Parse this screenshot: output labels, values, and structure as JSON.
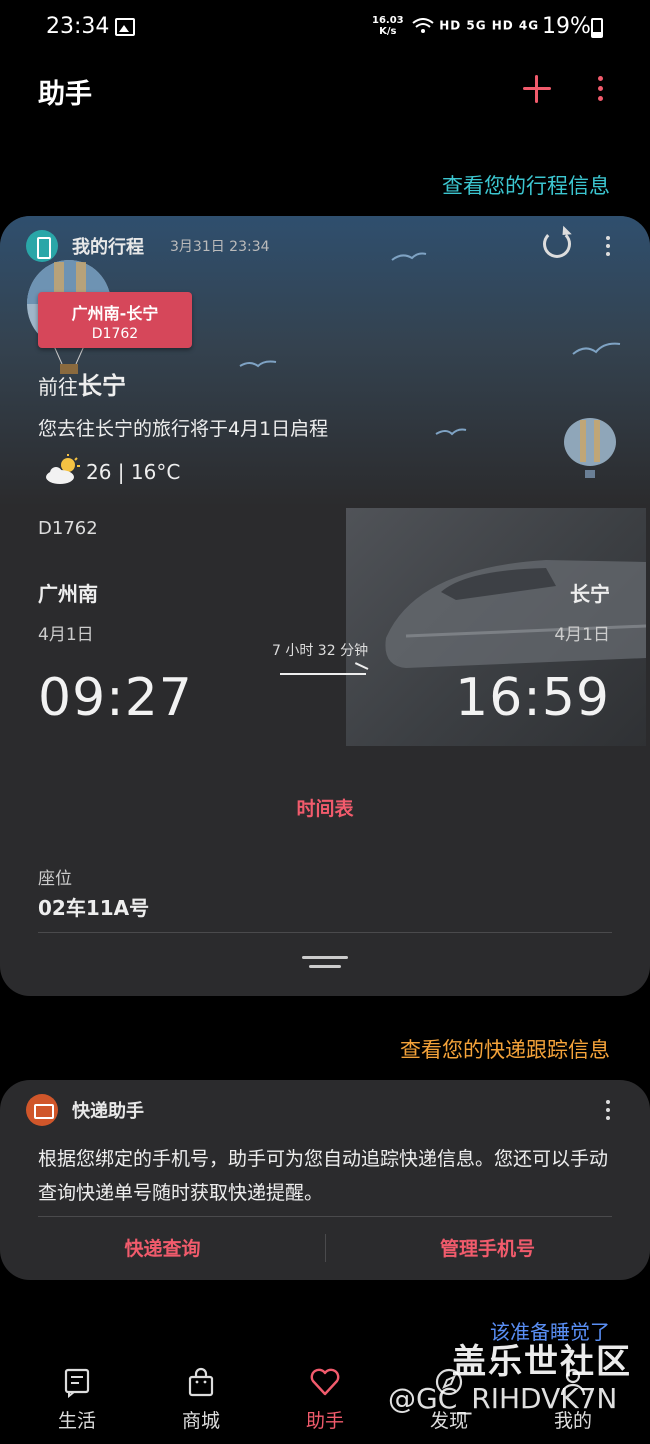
{
  "status_bar": {
    "time": "23:34",
    "speed_value": "16.03",
    "speed_unit": "K/s",
    "network": "HD 5G HD 4G",
    "battery": "19%"
  },
  "header": {
    "title": "助手",
    "add_icon": "plus-icon",
    "more_icon": "more-vertical-icon"
  },
  "trip_section": {
    "link": "查看您的行程信息",
    "card": {
      "title": "我的行程",
      "timestamp": "3月31日 23:34",
      "route_tag": {
        "name": "广州南-长宁",
        "code": "D1762"
      },
      "destination_prefix": "前往",
      "destination": "长宁",
      "description": "您去往长宁的旅行将于4月1日启程",
      "weather": "26 | 16°C",
      "train_code": "D1762",
      "from": {
        "station": "广州南",
        "date": "4月1日",
        "time": "09:27"
      },
      "to": {
        "station": "长宁",
        "date": "4月1日",
        "time": "16:59"
      },
      "duration": "7 小时 32 分钟",
      "timetable_label": "时间表",
      "seat_label": "座位",
      "seat_value": "02车11A号"
    }
  },
  "express_section": {
    "link": "查看您的快递跟踪信息",
    "card": {
      "title": "快递助手",
      "body": "根据您绑定的手机号，助手可为您自动追踪快递信息。您还可以手动查询快递单号随时获取快递提醒。",
      "button_query": "快递查询",
      "button_manage": "管理手机号"
    }
  },
  "sleep_link": "该准备睡觉了",
  "bottom_nav": [
    {
      "label": "生活",
      "icon": "life-icon"
    },
    {
      "label": "商城",
      "icon": "shop-bag-icon"
    },
    {
      "label": "助手",
      "icon": "heart-icon",
      "active": true
    },
    {
      "label": "发现",
      "icon": "discover-icon"
    },
    {
      "label": "我的",
      "icon": "profile-icon"
    }
  ],
  "watermark": {
    "main": "盖乐世社区",
    "sub": "@GC_RIHDVK7N"
  },
  "colors": {
    "accent": "#f15b6c",
    "trip_link": "#3cc6d0",
    "express_link": "#f5a33a",
    "sleep_link": "#5a8ff5",
    "card_bg": "#2b2b2d",
    "route_tag": "#d6475a"
  }
}
